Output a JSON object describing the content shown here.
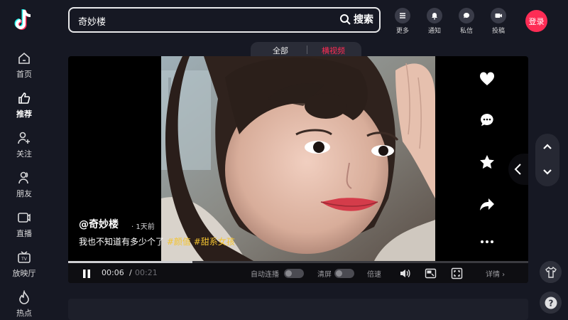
{
  "sidebar": {
    "items": [
      {
        "label": "首页",
        "icon": "home-icon",
        "active": false
      },
      {
        "label": "推荐",
        "icon": "thumbs-up-icon",
        "active": true
      },
      {
        "label": "关注",
        "icon": "follow-icon",
        "active": false
      },
      {
        "label": "朋友",
        "icon": "friends-icon",
        "active": false
      },
      {
        "label": "直播",
        "icon": "live-icon",
        "active": false
      },
      {
        "label": "放映厅",
        "icon": "tv-icon",
        "active": false
      },
      {
        "label": "热点",
        "icon": "fire-icon",
        "active": false
      }
    ]
  },
  "header": {
    "search_value": "奇妙楼",
    "search_button": "搜索",
    "more": "更多",
    "notify": "通知",
    "messages": "私信",
    "upload": "投稿",
    "login": "登录"
  },
  "tabs": {
    "all": "全部",
    "landscape": "横视频",
    "active": "横视频"
  },
  "video": {
    "author": "@奇妙楼",
    "posted": "· 1天前",
    "caption_text": "我也不知道有多少个了",
    "tags": [
      "#颜值",
      "#甜系女孩"
    ],
    "progress": 0.27
  },
  "controls": {
    "time_current": "00:06",
    "time_sep": "/",
    "time_total": "00:21",
    "autoplay": "自动连播",
    "clear_screen": "清屏",
    "speed": "倍速",
    "detail": "详情 ›"
  },
  "colors": {
    "accent": "#fe2c55",
    "tag": "#f4c430",
    "bg": "#161823"
  }
}
